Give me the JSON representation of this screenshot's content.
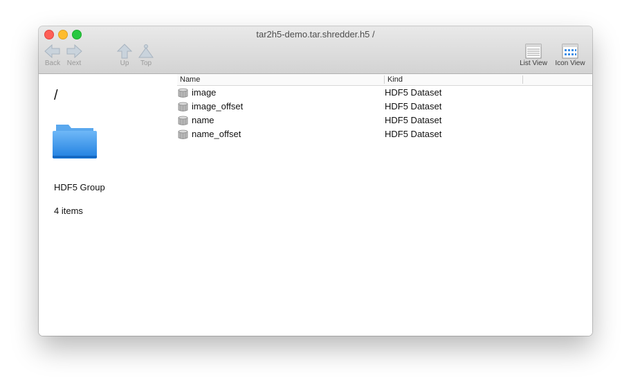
{
  "window": {
    "title": "tar2h5-demo.tar.shredder.h5 /"
  },
  "toolbar": {
    "back_label": "Back",
    "next_label": "Next",
    "up_label": "Up",
    "top_label": "Top",
    "list_view_label": "List View",
    "icon_view_label": "Icon View"
  },
  "sidebar": {
    "path": "/",
    "kind": "HDF5 Group",
    "count": "4 items"
  },
  "table": {
    "columns": [
      "Name",
      "Kind"
    ],
    "rows": [
      {
        "name": "image",
        "kind": "HDF5 Dataset"
      },
      {
        "name": "image_offset",
        "kind": "HDF5 Dataset"
      },
      {
        "name": "name",
        "kind": "HDF5 Dataset"
      },
      {
        "name": "name_offset",
        "kind": "HDF5 Dataset"
      }
    ]
  },
  "icons": {
    "folder": "folder-icon",
    "dataset": "database-icon"
  }
}
